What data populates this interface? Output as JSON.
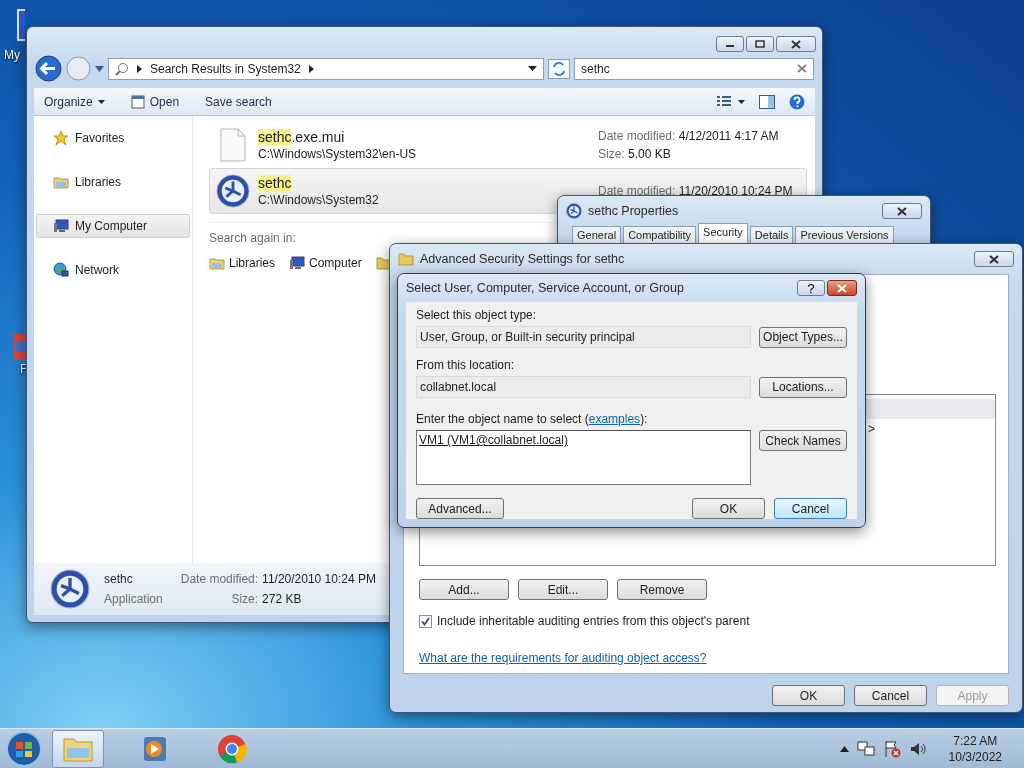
{
  "desktop": {
    "icons": [
      {
        "label": "My",
        "kind": "computer"
      },
      {
        "label": "F",
        "kind": "app"
      }
    ]
  },
  "explorer": {
    "address": {
      "crumb": "Search Results in System32"
    },
    "search": {
      "value": "sethc"
    },
    "toolbar": [
      {
        "label": "Organize",
        "kind": "menu"
      },
      {
        "label": "Open",
        "kind": "icon"
      },
      {
        "label": "Save search",
        "kind": "plain"
      }
    ],
    "nav": [
      {
        "label": "Favorites",
        "kind": "star",
        "selected": false
      },
      {
        "label": "Libraries",
        "kind": "library",
        "selected": false
      },
      {
        "label": "My Computer",
        "kind": "computer",
        "selected": true
      },
      {
        "label": "Network",
        "kind": "network",
        "selected": false
      }
    ],
    "results": [
      {
        "match": "sethc",
        "rest": ".exe.mui",
        "path": "C:\\Windows\\System32\\en-US",
        "kind": "file",
        "date_label": "Date modified:",
        "date": "4/12/2011 4:17 AM",
        "size_label": "Size:",
        "size": "5.00 KB",
        "selected": false
      },
      {
        "match": "sethc",
        "path": "C:\\Windows\\System32",
        "kind": "app",
        "date_label": "Date modified:",
        "date": "11/20/2010 10:24 PM",
        "selected": true
      }
    ],
    "search_again": {
      "label": "Search again in:",
      "places": [
        {
          "label": "Libraries",
          "kind": "library"
        },
        {
          "label": "Computer",
          "kind": "computer"
        }
      ]
    },
    "details": {
      "name": "sethc",
      "type": "Application",
      "date_label": "Date modified:",
      "date": "11/20/2010 10:24 PM",
      "size_label": "Size:",
      "size": "272 KB"
    }
  },
  "properties": {
    "title": "sethc Properties",
    "tabs": [
      {
        "label": "General",
        "selected": false
      },
      {
        "label": "Compatibility",
        "selected": false
      },
      {
        "label": "Security",
        "selected": true
      },
      {
        "label": "Details",
        "selected": false
      },
      {
        "label": "Previous Versions",
        "selected": false
      }
    ]
  },
  "advanced": {
    "title": "Advanced Security Settings for sethc",
    "rows": [
      {
        "selected": true
      },
      {
        "selected": false,
        "cell": ">"
      }
    ],
    "buttons": [
      "Add...",
      "Edit...",
      "Remove"
    ],
    "checkbox": {
      "label": "Include inheritable auditing entries from this object's parent",
      "checked": true
    },
    "link": "What are the requirements for auditing object access?",
    "footer": [
      {
        "label": "OK",
        "disabled": false
      },
      {
        "label": "Cancel",
        "disabled": false
      },
      {
        "label": "Apply",
        "disabled": true
      }
    ]
  },
  "select_dialog": {
    "title": "Select User, Computer, Service Account, or Group",
    "help": "?",
    "type_label": "Select this object type:",
    "type_value": "User, Group, or Built-in security principal",
    "type_button": "Object Types...",
    "location_label": "From this location:",
    "location_value": "collabnet.local",
    "location_button": "Locations...",
    "name_label_before": "Enter the object name to select (",
    "name_link": "examples",
    "name_label_after": "):",
    "name_value": "VM1 (VM1@collabnet.local)",
    "check_button": "Check Names",
    "advanced_button": "Advanced...",
    "footer": [
      {
        "label": "OK",
        "hover": false
      },
      {
        "label": "Cancel",
        "hover": true
      }
    ]
  },
  "taskbar": {
    "apps": [
      {
        "kind": "explorer",
        "selected": true
      },
      {
        "kind": "media",
        "selected": false
      },
      {
        "kind": "browser",
        "selected": false
      }
    ],
    "clock": {
      "time": "7:22 AM",
      "date": "10/3/2022"
    }
  }
}
